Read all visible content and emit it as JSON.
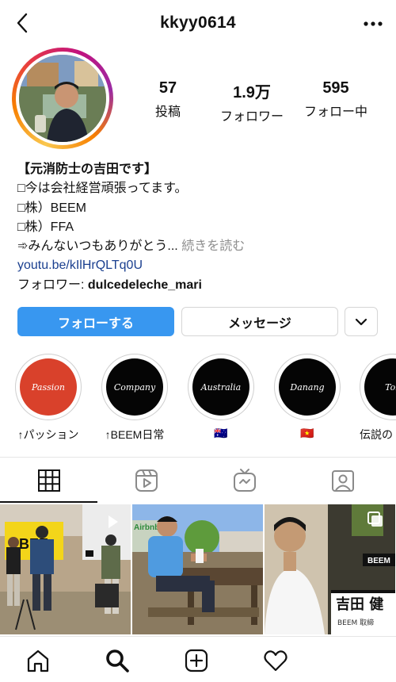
{
  "header": {
    "username": "kkyy0614"
  },
  "stats": [
    {
      "value": "57",
      "label": "投稿"
    },
    {
      "value": "1.9万",
      "label": "フォロワー"
    },
    {
      "value": "595",
      "label": "フォロー中"
    }
  ],
  "bio": {
    "name": "【元消防士の吉田です】",
    "lines": [
      "□今は会社経営頑張ってます。",
      "□株）BEEM",
      "□株）FFA"
    ],
    "truncated_line": "➾みんないつもありがとう...",
    "more_label": "続きを読む",
    "link": "youtu.be/kIlHrQLTq0U",
    "followers_prefix": "フォロワー: ",
    "followers_name": "dulcedeleche_mari"
  },
  "buttons": {
    "follow": "フォローする",
    "message": "メッセージ"
  },
  "highlights": [
    {
      "cover_text": "Passion",
      "label": "↑パッション",
      "color": "#d9412b"
    },
    {
      "cover_text": "Company",
      "label": "↑BEEM日常",
      "color": "#050505"
    },
    {
      "cover_text": "Australia",
      "label": "🇦🇺",
      "color": "#050505"
    },
    {
      "cover_text": "Danang",
      "label": "🇻🇳",
      "color": "#050505"
    },
    {
      "cover_text": "Tok",
      "label": "伝説の",
      "color": "#050505"
    }
  ],
  "tabs": [
    {
      "name": "grid-icon",
      "active": true
    },
    {
      "name": "reels-icon",
      "active": false
    },
    {
      "name": "igtv-icon",
      "active": false
    },
    {
      "name": "tagged-icon",
      "active": false
    }
  ],
  "posts": [
    {
      "overlay_text": "BEE"
    },
    {
      "overlay_text": "Airbnb"
    },
    {
      "overlay_text": "BEEM",
      "caption_name": "吉田 健",
      "caption_sub": "BEEM 取締"
    }
  ],
  "bottom_nav": [
    "home-icon",
    "search-icon",
    "new-post-icon",
    "activity-icon"
  ],
  "colors": {
    "accent": "#3897f0",
    "link": "#1a3f8f"
  }
}
